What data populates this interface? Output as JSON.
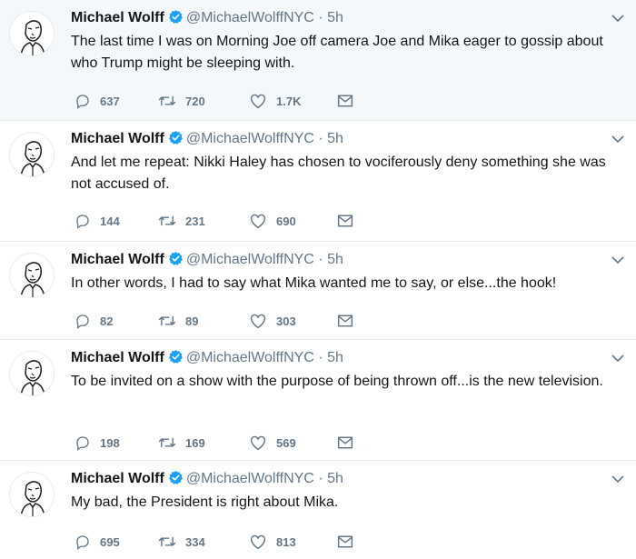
{
  "tweets": [
    {
      "name": "Michael Wolff",
      "handle": "@MichaelWolffNYC",
      "sep": "·",
      "time": "5h",
      "text": "The last time I was on Morning Joe off camera Joe and Mika eager to gossip about who Trump might be sleeping with.",
      "replies": "637",
      "retweets": "720",
      "likes": "1.7K"
    },
    {
      "name": "Michael Wolff",
      "handle": "@MichaelWolffNYC",
      "sep": "·",
      "time": "5h",
      "text": "And let me repeat: Nikki Haley has chosen to vociferously deny something she was not accused of.",
      "replies": "144",
      "retweets": "231",
      "likes": "690"
    },
    {
      "name": "Michael Wolff",
      "handle": "@MichaelWolffNYC",
      "sep": "·",
      "time": "5h",
      "text": "In other words, I had to say what Mika wanted me to say, or else...the hook!",
      "replies": "82",
      "retweets": "89",
      "likes": "303"
    },
    {
      "name": "Michael Wolff",
      "handle": "@MichaelWolffNYC",
      "sep": "·",
      "time": "5h",
      "text": "To be invited on a show with the purpose of being thrown off...is the new television.",
      "replies": "198",
      "retweets": "169",
      "likes": "569"
    },
    {
      "name": "Michael Wolff",
      "handle": "@MichaelWolffNYC",
      "sep": "·",
      "time": "5h",
      "text": "My bad, the President is right about Mika.",
      "replies": "695",
      "retweets": "334",
      "likes": "813"
    }
  ],
  "icons": {
    "verified": "verified-badge-icon",
    "caret": "chevron-down-icon",
    "reply": "reply-icon",
    "retweet": "retweet-icon",
    "like": "heart-icon",
    "dm": "envelope-icon"
  },
  "colors": {
    "highlight_bg": "#f5f8fa",
    "verified": "#1da1f2",
    "meta_gray": "#657786",
    "divider": "#e6ecf0"
  }
}
